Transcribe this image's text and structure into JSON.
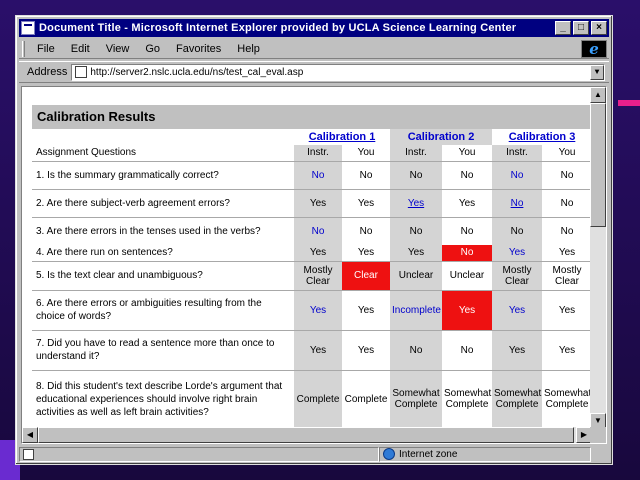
{
  "window": {
    "title": "Document Title - Microsoft Internet Explorer provided by UCLA Science Learning Center",
    "controls": {
      "minimize": "_",
      "maximize": "□",
      "close": "×"
    }
  },
  "menu": [
    "File",
    "Edit",
    "View",
    "Go",
    "Favorites",
    "Help"
  ],
  "address": {
    "label": "Address",
    "url": "http://server2.nslc.ucla.edu/ns/test_cal_eval.asp"
  },
  "page": {
    "heading": "Calibration Results",
    "calibrations": [
      "Calibration 1",
      "Calibration 2",
      "Calibration 3"
    ],
    "questions_header": "Assignment Questions",
    "col_instr": "Instr.",
    "col_you": "You",
    "rows": [
      {
        "q": "1. Is the summary grammatically correct?",
        "cells": [
          "No",
          "No",
          "No",
          "No",
          "No",
          "No"
        ]
      },
      {
        "q": "2. Are there subject-verb agreement errors?",
        "cells": [
          "Yes",
          "Yes",
          "Yes",
          "Yes",
          "No",
          "No"
        ]
      },
      {
        "q": "3. Are there errors in the tenses used in the verbs?",
        "cells": [
          "No",
          "No",
          "No",
          "No",
          "No",
          "No"
        ]
      },
      {
        "q": "4. Are there run on sentences?",
        "cells": [
          "Yes",
          "Yes",
          "Yes",
          "No",
          "Yes",
          "Yes"
        ]
      },
      {
        "q": "5. Is the text clear and unambiguous?",
        "cells": [
          "Mostly Clear",
          "Clear",
          "Unclear",
          "Unclear",
          "Mostly Clear",
          "Mostly Clear"
        ]
      },
      {
        "q": "6. Are there errors or ambiguities resulting from the choice of words?",
        "cells": [
          "Yes",
          "Yes",
          "Incomplete",
          "Yes",
          "Yes",
          "Yes"
        ]
      },
      {
        "q": "7. Did you have to read a sentence more than once to understand it?",
        "cells": [
          "Yes",
          "Yes",
          "No",
          "No",
          "Yes",
          "Yes"
        ]
      },
      {
        "q": "8. Did this student's text describe Lorde's argument that educational experiences should involve right brain activities as well as left brain activities?",
        "cells": [
          "Complete",
          "Complete",
          "Somewhat Complete",
          "Somewhat Complete",
          "Somewhat Complete",
          "Somewhat Complete"
        ]
      }
    ]
  },
  "status": {
    "zone": "Internet zone"
  },
  "colors": {
    "mismatch": "#ee1111",
    "instr_link": "#0000cc",
    "titlebar": "#000080"
  }
}
